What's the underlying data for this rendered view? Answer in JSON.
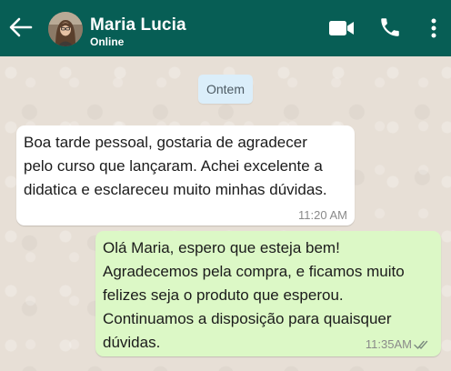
{
  "header": {
    "contact_name": "Maria Lucia",
    "status": "Online",
    "icons": [
      "arrow-left-icon",
      "video-camera-icon",
      "phone-icon",
      "more-vertical-icon"
    ],
    "color": "#075e55"
  },
  "chat": {
    "date_label": "Ontem",
    "messages": [
      {
        "direction": "incoming",
        "text": "Boa tarde pessoal, gostaria de agradecer\npelo curso que lançaram. Achei excelente a\ndidatica e esclareceu muito minhas dúvidas.",
        "time": "11:20 AM",
        "color": "#ffffff"
      },
      {
        "direction": "outgoing",
        "text": "Olá Maria, espero que esteja bem!\nAgradecemos pela compra, e ficamos muito\nfelizes seja o produto que esperou.\nContinuamos a disposição para quaisquer\ndúvidas.",
        "time": "11:35AM",
        "status_icon": "double-check-icon",
        "color": "#dcf8c6"
      }
    ]
  }
}
